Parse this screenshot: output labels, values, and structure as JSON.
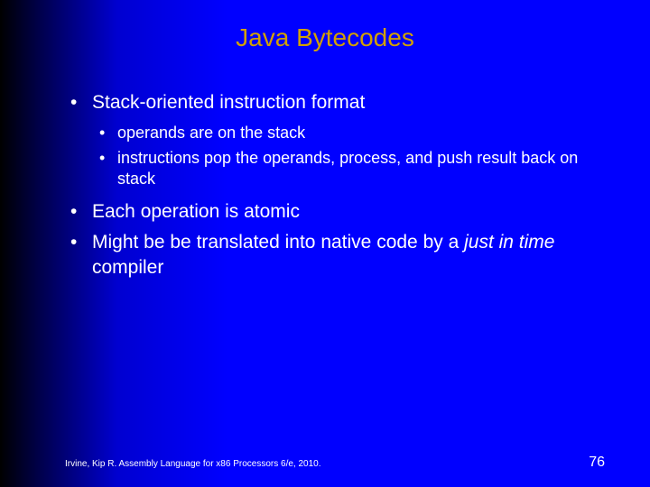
{
  "title": "Java Bytecodes",
  "bullets": {
    "b0": "Stack-oriented instruction format",
    "b0_sub": {
      "s0": "operands are on the stack",
      "s1": "instructions pop the operands, process, and push result back on stack"
    },
    "b1": "Each operation is atomic",
    "b2_pre": "Might be be translated into native code by a ",
    "b2_em": "just in time",
    "b2_post": " compiler"
  },
  "footer": {
    "citation": "Irvine, Kip R. Assembly Language for x86 Processors 6/e, 2010.",
    "page": "76"
  }
}
